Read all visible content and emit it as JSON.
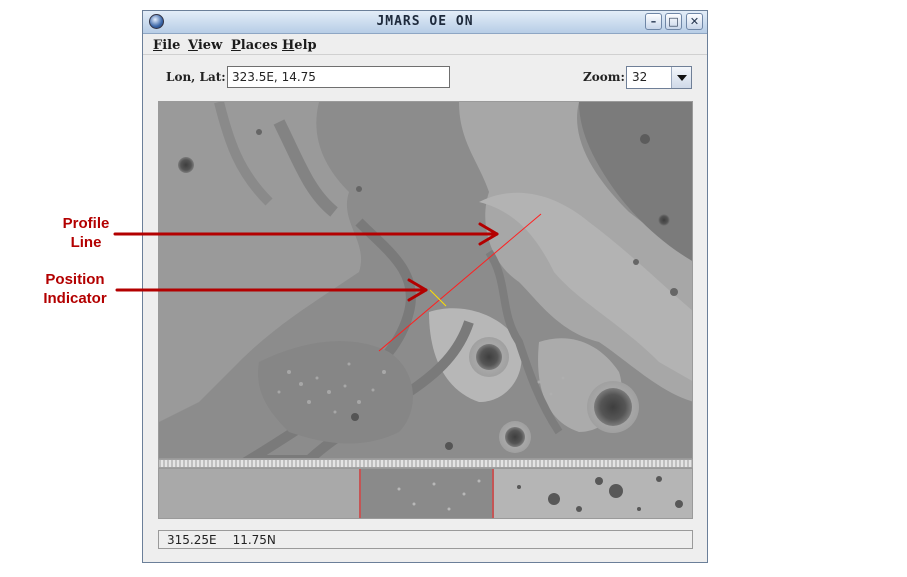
{
  "annotations": {
    "profile_line": [
      "Profile",
      "Line"
    ],
    "position_indicator": [
      "Position",
      "Indicator"
    ],
    "color": "#b30000"
  },
  "window": {
    "title": "JMARS OE ON",
    "controls": {
      "minimize": "–",
      "maximize": "□",
      "close": "✕"
    }
  },
  "menubar": [
    {
      "mnemonic": "F",
      "rest": "ile"
    },
    {
      "mnemonic": "V",
      "rest": "iew"
    },
    {
      "mnemonic": "P",
      "rest": "laces"
    },
    {
      "mnemonic": "H",
      "rest": "elp"
    }
  ],
  "toolbar": {
    "lonlat_label": "Lon, Lat:",
    "lonlat_value": "323.5E, 14.75",
    "zoom_label": "Zoom:",
    "zoom_value": "32"
  },
  "map": {
    "overlay_color": "#ff2020",
    "indicator_color": "#ffe000"
  },
  "status": {
    "lon": "315.25E",
    "lat": "11.75N"
  },
  "icons": [
    "app-globe-icon",
    "minimize-icon",
    "maximize-icon",
    "close-icon",
    "chevron-down-icon"
  ]
}
